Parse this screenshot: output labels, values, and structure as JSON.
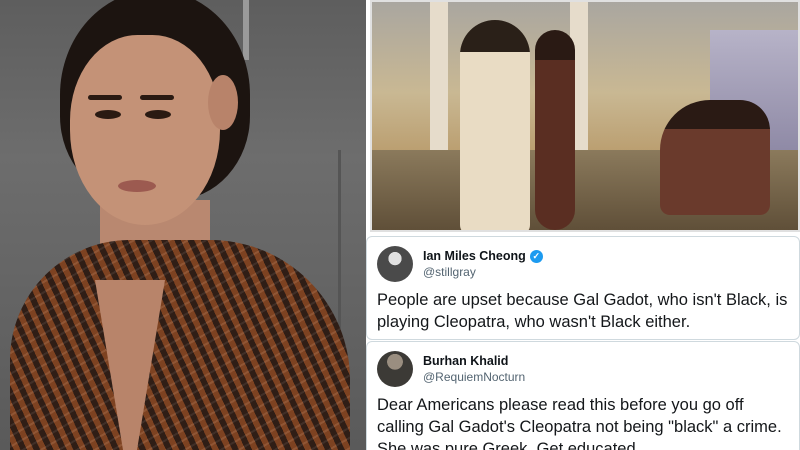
{
  "photo_left": {
    "subject": "gal-gadot-photo"
  },
  "painting": {
    "subject": "cleopatra-painting"
  },
  "tweets": [
    {
      "display_name": "Ian Miles Cheong",
      "handle": "@stillgray",
      "verified": true,
      "verified_glyph": "✓",
      "text": "People are upset because Gal Gadot, who isn't Black, is playing Cleopatra, who wasn't Black either."
    },
    {
      "display_name": "Burhan Khalid",
      "handle": "@RequiemNocturn",
      "verified": false,
      "text": "Dear Americans please read this before you go off calling Gal Gadot's Cleopatra not being \"black\" a crime. She was pure Greek. Get educated."
    }
  ],
  "colors": {
    "verified_blue": "#1d9bf0",
    "handle_gray": "#536471",
    "text_dark": "#14171a"
  }
}
